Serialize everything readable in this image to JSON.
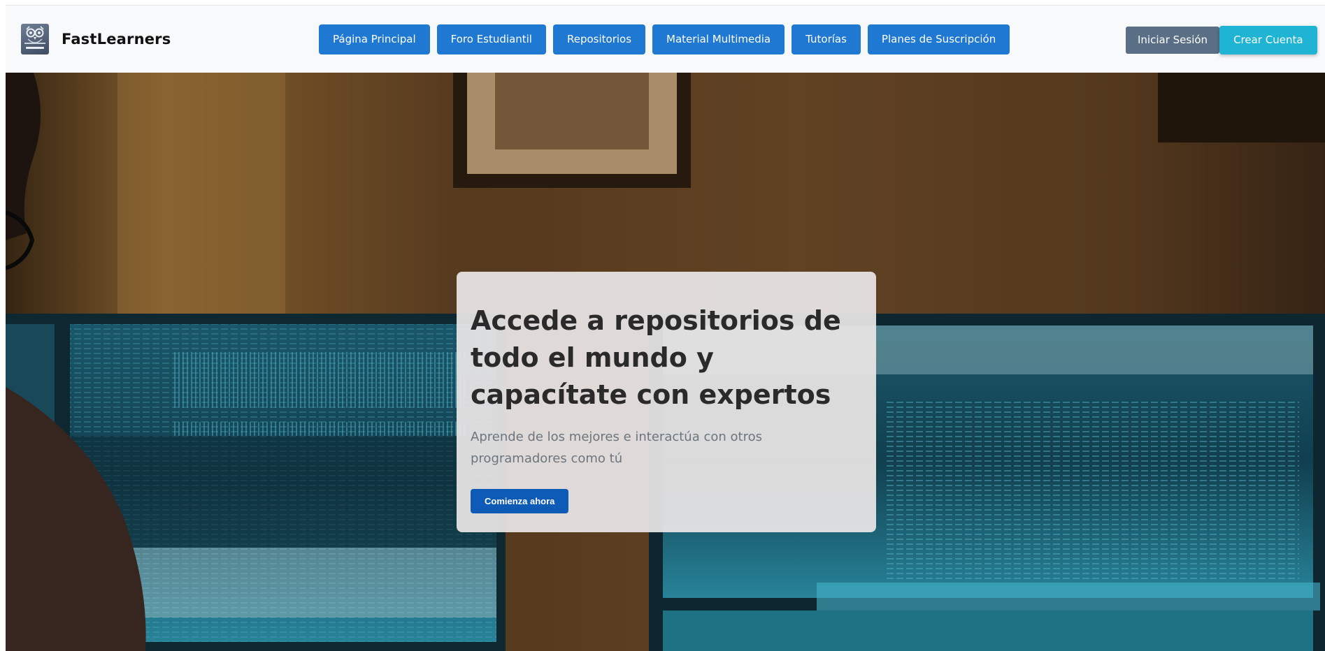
{
  "brand": {
    "name": "FastLearners",
    "logo_icon": "owl-logo-icon"
  },
  "nav": {
    "items": [
      {
        "label": "Página Principal"
      },
      {
        "label": "Foro Estudiantil"
      },
      {
        "label": "Repositorios"
      },
      {
        "label": "Material Multimedia"
      },
      {
        "label": "Tutorías"
      },
      {
        "label": "Planes de Suscripción"
      }
    ]
  },
  "auth": {
    "login_label": "Iniciar Sesión",
    "signup_label": "Crear Cuenta"
  },
  "hero": {
    "title": "Accede a repositorios de todo el mundo y capacítate con expertos",
    "subtitle": "Aprende de los mejores e interactúa con otros programadores como tú",
    "cta_label": "Comienza ahora"
  },
  "colors": {
    "nav_button": "#1f78d1",
    "login_button": "#5a6f86",
    "signup_button": "#1fb3d4",
    "cta_button": "#0d5bb7",
    "header_bg": "#f8f9fa"
  }
}
